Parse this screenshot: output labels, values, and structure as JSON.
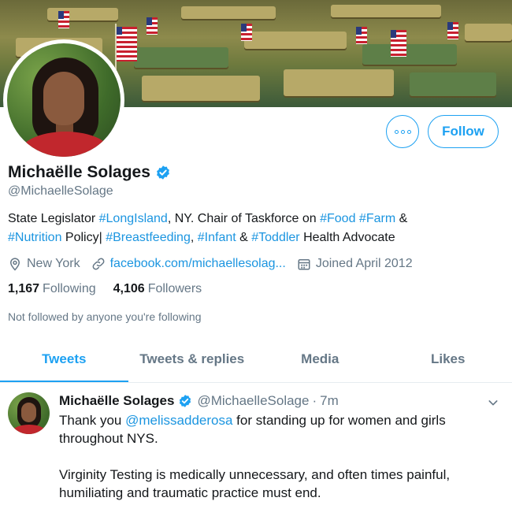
{
  "profile": {
    "name": "Michaëlle Solages",
    "handle": "@MichaelleSolage",
    "verified": true,
    "bio": {
      "p1": "State Legislator ",
      "t1": "#LongIsland",
      "p2": ", NY. Chair of Taskforce on ",
      "t2": "#Food",
      "p3": " ",
      "t3": "#Farm",
      "p4": " & ",
      "t4": "#Nutrition",
      "p5": " Policy| ",
      "t5": "#Breastfeeding",
      "p6": ", ",
      "t6": "#Infant",
      "p7": " & ",
      "t7": "#Toddler",
      "p8": " Health Advocate"
    },
    "location": "New York",
    "website": "facebook.com/michaellesolag...",
    "joined": "Joined April 2012",
    "following_count": "1,167",
    "following_label": "Following",
    "followers_count": "4,106",
    "followers_label": "Followers",
    "not_followed_text": "Not followed by anyone you're following"
  },
  "actions": {
    "follow_label": "Follow",
    "more_icon": "more-dots-icon"
  },
  "tabs": [
    {
      "label": "Tweets",
      "active": true
    },
    {
      "label": "Tweets & replies",
      "active": false
    },
    {
      "label": "Media",
      "active": false
    },
    {
      "label": "Likes",
      "active": false
    }
  ],
  "tweet": {
    "name": "Michaëlle Solages",
    "handle": "@MichaelleSolage",
    "separator": "·",
    "time": "7m",
    "text_before_mention": "Thank you ",
    "mention": "@melissadderosa",
    "text_after_mention": " for standing up for women and girls throughout NYS.",
    "text_p2": "Virginity Testing is medically unnecessary, and often times painful, humiliating and traumatic practice must end."
  },
  "colors": {
    "accent": "#1da1f2",
    "link": "#1b95e0",
    "muted": "#657786",
    "text": "#14171a"
  }
}
